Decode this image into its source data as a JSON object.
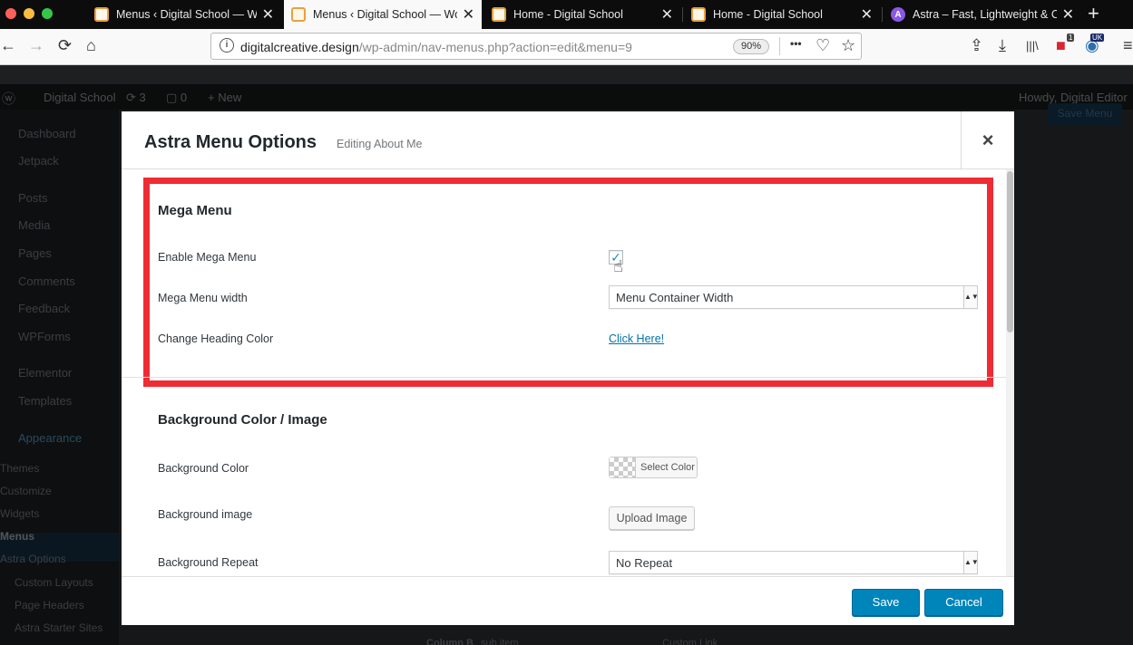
{
  "browser": {
    "tabs": [
      {
        "title": "Menus ‹ Digital School — WordPress",
        "active": false,
        "icon": "wordpress-site-icon"
      },
      {
        "title": "Menus ‹ Digital School — WordPress",
        "active": true,
        "icon": "wordpress-site-icon"
      },
      {
        "title": "Home - Digital School",
        "active": false,
        "icon": "site-icon"
      },
      {
        "title": "Home - Digital School",
        "active": false,
        "icon": "site-icon"
      },
      {
        "title": "Astra – Fast, Lightweight & Customizable",
        "active": false,
        "icon": "astra-icon"
      }
    ],
    "astra_glyph": "A",
    "close_glyph": "✕",
    "new_tab_glyph": "+",
    "url_domain": "digitalcreative.design",
    "url_path": "/wp-admin/nav-menus.php?action=edit&menu=9",
    "zoom": "90%",
    "info_glyph": "i",
    "toolbar_glyphs": {
      "back": "←",
      "forward": "→",
      "reload": "⟳",
      "home": "⌂",
      "more": "•••",
      "pocket": "♡",
      "bookmark": "☆",
      "save": "⇪",
      "download": "⤓",
      "library": "|||\\",
      "ext1": "■",
      "ext2": "◉",
      "menu": "≡"
    },
    "badges": {
      "ext1": "1",
      "ext2": "UK"
    }
  },
  "admin_bar": {
    "wp_glyph": "ⓦ",
    "site_name": "Digital School",
    "updates": "⟳ 3",
    "comments": "▢ 0",
    "new": "+ New",
    "greeting": "Howdy, Digital Editor"
  },
  "sidebar": {
    "items": [
      "Dashboard",
      "Jetpack",
      "Posts",
      "Media",
      "Pages",
      "Comments",
      "Feedback",
      "WPForms",
      "Elementor",
      "Templates",
      "Appearance"
    ],
    "sub_items": [
      "Themes",
      "Customize",
      "Widgets",
      "Menus",
      "Astra Options",
      "Custom Layouts",
      "Page Headers",
      "Astra Starter Sites"
    ]
  },
  "background": {
    "save_menu": "Save Menu",
    "row_column": "Column B",
    "row_sub": "sub item",
    "row_type": "Custom Link"
  },
  "modal": {
    "title": "Astra Menu Options",
    "subtitle": "Editing About Me",
    "close_glyph": "×",
    "mega_menu": {
      "heading": "Mega Menu",
      "enable_label": "Enable Mega Menu",
      "enabled": true,
      "check_glyph": "✓",
      "cursor_glyph": "☝",
      "width_label": "Mega Menu width",
      "width_value": "Menu Container Width",
      "heading_color_label": "Change Heading Color",
      "heading_color_link": "Click Here!"
    },
    "background": {
      "heading": "Background Color / Image",
      "color_label": "Background Color",
      "color_button": "Select Color",
      "image_label": "Background image",
      "image_button": "Upload Image",
      "repeat_label": "Background Repeat",
      "repeat_value": "No Repeat"
    },
    "select_arrow": "▲▼",
    "footer": {
      "save": "Save",
      "cancel": "Cancel"
    }
  },
  "colors": {
    "highlight": "#ef2b33",
    "primary_button": "#0085ba",
    "link": "#0073aa"
  }
}
